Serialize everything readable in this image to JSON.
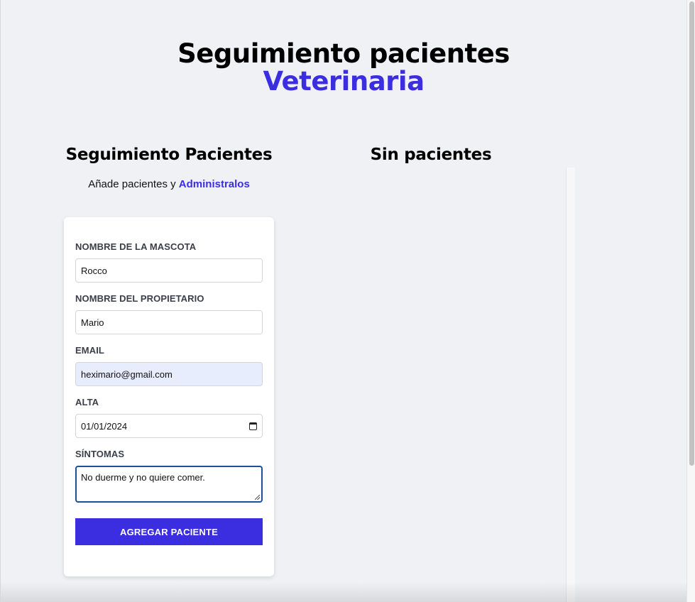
{
  "header": {
    "title_line1": "Seguimiento pacientes",
    "title_line2": "Veterinaria"
  },
  "form_section": {
    "title": "Seguimiento Pacientes",
    "subtitle_prefix": "Añade pacientes y ",
    "subtitle_accent": "Administralos",
    "fields": {
      "pet_name": {
        "label": "NOMBRE DE LA MASCOTA",
        "value": "Rocco"
      },
      "owner_name": {
        "label": "NOMBRE DEL PROPIETARIO",
        "value": "Mario"
      },
      "email": {
        "label": "EMAIL",
        "value": "heximario@gmail.com"
      },
      "discharge": {
        "label": "ALTA",
        "value": "01/01/2024"
      },
      "symptoms": {
        "label": "SÍNTOMAS",
        "value": "No duerme y no quiere comer."
      }
    },
    "submit_label": "AGREGAR PACIENTE"
  },
  "list_section": {
    "title": "Sin pacientes"
  },
  "colors": {
    "accent": "#3b2ee0",
    "background": "#f0f1f5",
    "card": "#ffffff",
    "autofill": "#e8edfd",
    "focus_border": "#1f4f9a"
  }
}
